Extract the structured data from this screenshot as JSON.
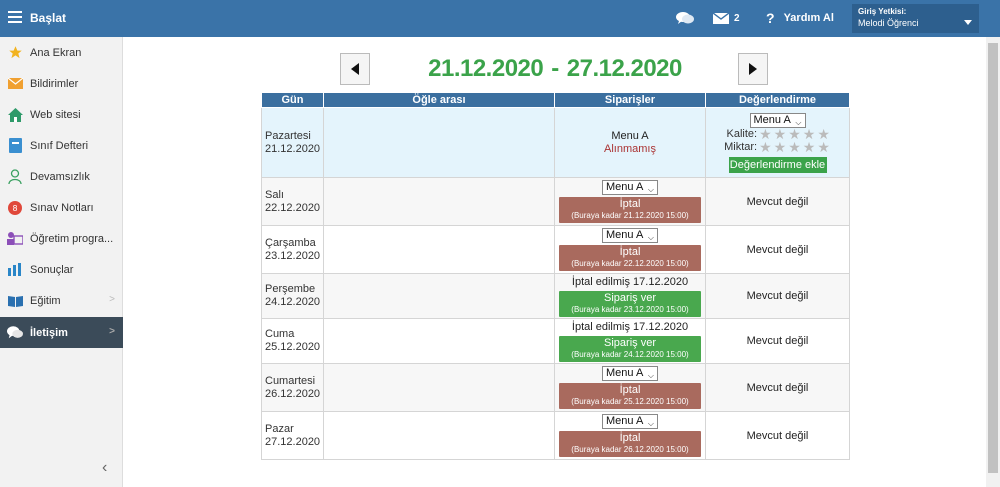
{
  "header": {
    "title": "Başlat",
    "mail_count": "2",
    "help": "Yardım Al",
    "auth_label": "Giriş Yetkisi:",
    "auth_value": "Melodi Öğrenci"
  },
  "sidebar": {
    "items": [
      {
        "label": "Ana Ekran",
        "icon": "star-icon"
      },
      {
        "label": "Bildirimler",
        "icon": "envelope-icon"
      },
      {
        "label": "Web sitesi",
        "icon": "home-icon"
      },
      {
        "label": "Sınıf Defteri",
        "icon": "notebook-icon"
      },
      {
        "label": "Devamsızlık",
        "icon": "person-icon"
      },
      {
        "label": "Sınav Notları",
        "icon": "grade-icon"
      },
      {
        "label": "Öğretim progra...",
        "icon": "person-board-icon"
      },
      {
        "label": "Sonuçlar",
        "icon": "bar-chart-icon"
      },
      {
        "label": "Eğitim",
        "icon": "book-icon"
      },
      {
        "label": "İletişim",
        "icon": "chat-icon"
      }
    ]
  },
  "week": {
    "start": "21.12.2020",
    "sep": "-",
    "end": "27.12.2020"
  },
  "table": {
    "headers": [
      "Gün",
      "Öğle arası",
      "Siparişler",
      "Değerlendirme"
    ],
    "rows": [
      {
        "day": "Pazartesi",
        "date": "21.12.2020",
        "menu": "Menu A",
        "status": "Alınmamış",
        "quality_label": "Kalite:",
        "quantity_label": "Miktar:",
        "select": "Menu A",
        "eval_button": "Değerlendirme ekle"
      },
      {
        "day": "Salı",
        "date": "22.12.2020",
        "select": "Menu A",
        "btn": "İptal",
        "deadline": "(Buraya kadar 21.12.2020 15:00)",
        "eval": "Mevcut değil"
      },
      {
        "day": "Çarşamba",
        "date": "23.12.2020",
        "select": "Menu A",
        "btn": "İptal",
        "deadline": "(Buraya kadar 22.12.2020 15:00)",
        "eval": "Mevcut değil"
      },
      {
        "day": "Perşembe",
        "date": "24.12.2020",
        "cancelled": "İptal edilmiş 17.12.2020",
        "btn": "Sipariş ver",
        "deadline": "(Buraya kadar 23.12.2020 15:00)",
        "eval": "Mevcut değil"
      },
      {
        "day": "Cuma",
        "date": "25.12.2020",
        "cancelled": "İptal edilmiş 17.12.2020",
        "btn": "Sipariş ver",
        "deadline": "(Buraya kadar 24.12.2020 15:00)",
        "eval": "Mevcut değil"
      },
      {
        "day": "Cumartesi",
        "date": "26.12.2020",
        "select": "Menu A",
        "btn": "İptal",
        "deadline": "(Buraya kadar 25.12.2020 15:00)",
        "eval": "Mevcut değil"
      },
      {
        "day": "Pazar",
        "date": "27.12.2020",
        "select": "Menu A",
        "btn": "İptal",
        "deadline": "(Buraya kadar 26.12.2020 15:00)",
        "eval": "Mevcut değil"
      }
    ]
  },
  "colors": {
    "topbar": "#3a73a8",
    "accent_green": "#3ba34a",
    "cancel": "#a96a5e",
    "header": "#3b6f9f"
  }
}
